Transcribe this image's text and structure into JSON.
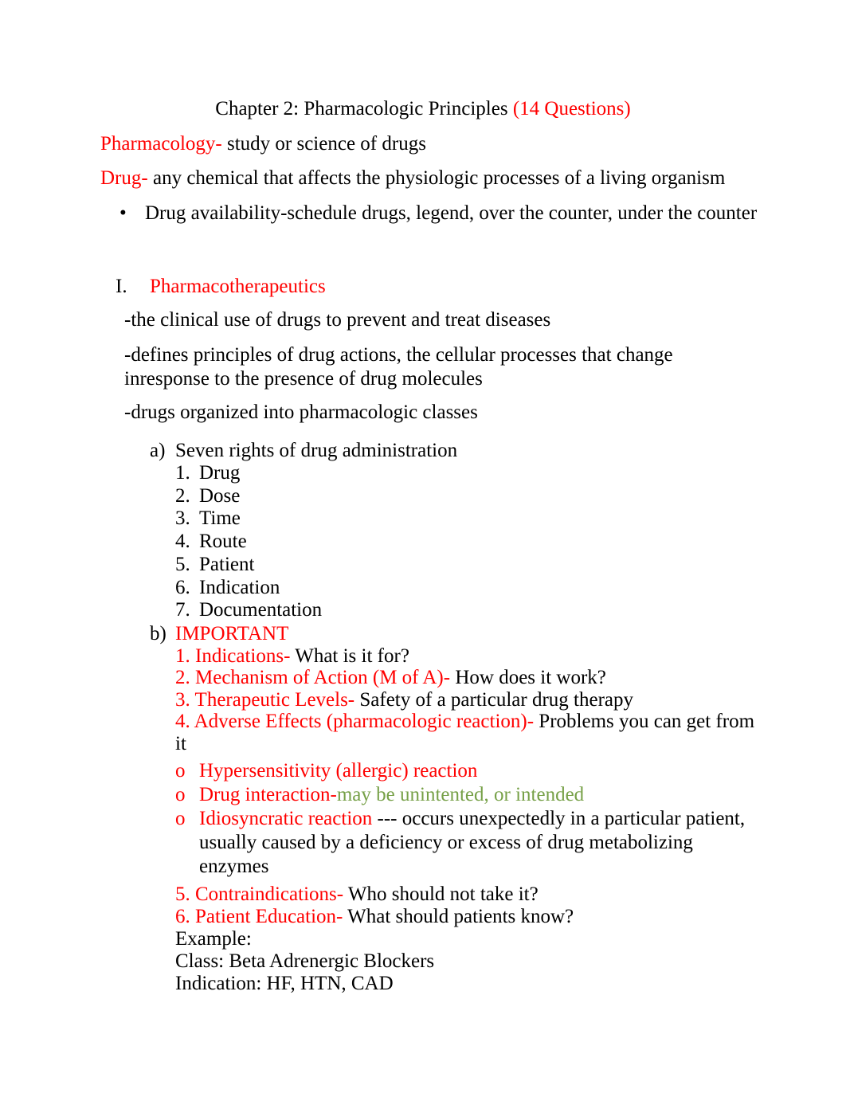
{
  "document": {
    "title_main": "Chapter 2: Pharmacologic Principles ",
    "title_questions": "(14 Questions)",
    "definitions": [
      {
        "term": "Pharmacology-",
        "definition": " study or science of drugs"
      },
      {
        "term": "Drug-",
        "definition": " any chemical that affects the physiologic processes of a living organism"
      }
    ],
    "top_bullet": {
      "marker": "•",
      "text": "Drug availability-schedule drugs, legend, over the counter, under the counter"
    },
    "section": {
      "marker": "I.",
      "heading": "Pharmacotherapeutics",
      "notes": [
        "-the clinical use of drugs to prevent and treat diseases",
        "-defines principles of drug actions, the cellular processes that change inresponse to the presence of drug molecules",
        "-drugs organized into pharmacologic classes"
      ],
      "item_a": {
        "marker": "a)",
        "label": "Seven rights of drug administration",
        "rights": [
          {
            "marker": "1.",
            "label": "Drug"
          },
          {
            "marker": "2.",
            "label": "Dose"
          },
          {
            "marker": "3.",
            "label": "Time"
          },
          {
            "marker": "4.",
            "label": "Route"
          },
          {
            "marker": "5.",
            "label": "Patient"
          },
          {
            "marker": "6.",
            "label": "Indication"
          },
          {
            "marker": "7.",
            "label": "Documentation"
          }
        ]
      },
      "item_b": {
        "marker": "b)",
        "label": "IMPORTANT",
        "points": [
          {
            "red": "1. Indications-",
            "black": " What is it for?"
          },
          {
            "red": "2. Mechanism of Action (M of A)-",
            "black": " How does it work?"
          },
          {
            "red": "3. Therapeutic Levels-",
            "black": " Safety of a particular drug therapy"
          },
          {
            "red": "4. Adverse Effects (pharmacologic reaction)-",
            "black": " Problems you can get from it"
          }
        ],
        "reactions": [
          {
            "marker": "o",
            "red": "Hypersensitivity (allergic) reaction",
            "green": "",
            "black": ""
          },
          {
            "marker": "o",
            "red": "Drug interaction-",
            "green": "may be unintented, or intended",
            "black": ""
          },
          {
            "marker": "o",
            "red": "Idiosyncratic reaction",
            "green": "",
            "black": " --- occurs unexpectedly in  a particular patient, usually caused by a deficiency or excess of drug metabolizing enzymes"
          }
        ],
        "points_tail": [
          {
            "red": "5. Contraindications-",
            "black": " Who should not take it?"
          },
          {
            "red": "6. Patient Education-",
            "black": " What should patients know?"
          }
        ],
        "example_lines": [
          "Example:",
          "Class: Beta Adrenergic Blockers",
          "Indication: HF, HTN, CAD"
        ]
      }
    }
  },
  "colors": {
    "red": "#FF0000",
    "green": "#76A047",
    "black": "#000000",
    "page_background": "#FFFFFF"
  }
}
